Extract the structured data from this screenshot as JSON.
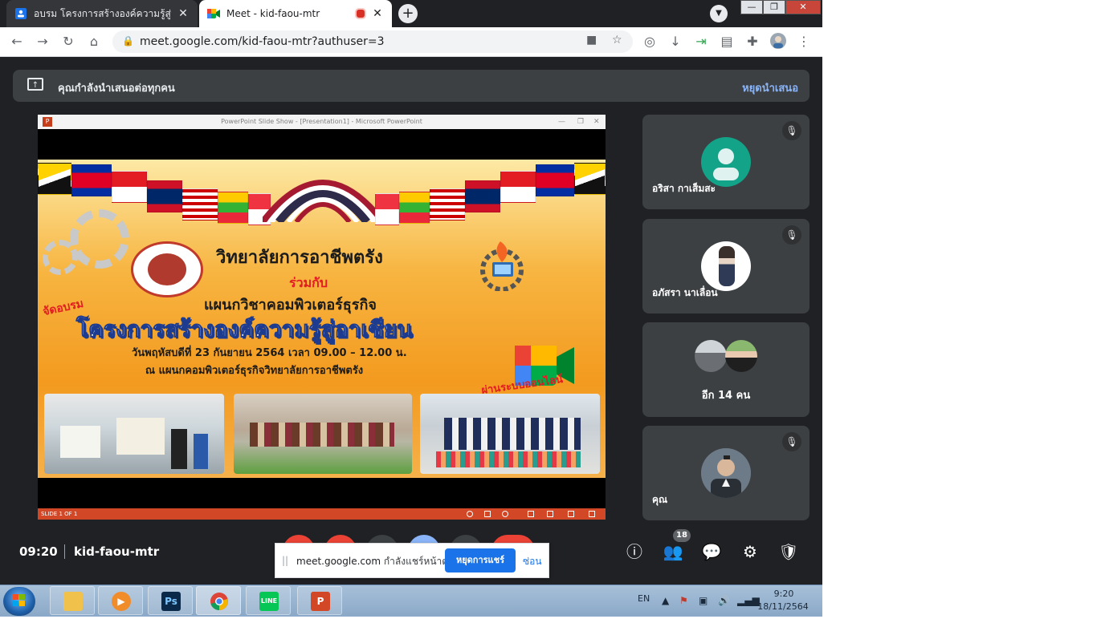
{
  "browser": {
    "tabs": [
      {
        "title": "อบรม โครงการสร้างองค์ความรู้สู่อาเซีย",
        "active": false
      },
      {
        "title": "Meet - kid-faou-mtr",
        "active": true
      }
    ],
    "new_tab": "+",
    "url": "meet.google.com/kid-faou-mtr?authuser=3"
  },
  "meet": {
    "banner_text": "คุณกำลังนำเสนอต่อทุกคน",
    "banner_stop": "หยุดนำเสนอ",
    "clock": "09:20",
    "meeting_code": "kid-faou-mtr",
    "participant_badge": "18"
  },
  "slide": {
    "window_title": "PowerPoint Slide Show - [Presentation1] - Microsoft PowerPoint",
    "line1": "วิทยาลัยการอาชีพตรัง",
    "line2": "ร่วมกับ",
    "line3": "แผนกวิชาคอมพิวเตอร์ธุรกิจ",
    "label_left": "จัดอบรม",
    "headline": "โครงการสร้างองค์ความรู้สู่อาเซียน",
    "date_line": "วันพฤหัสบดีที่ 23 กันยายน 2564 เวลา 09.00 – 12.00 น.",
    "place_line": "ณ แผนกคอมพิวเตอร์ธุรกิจวิทยาลัยการอาชีพตรัง",
    "online_label": "ผ่านระบบออนไลน์",
    "status_text": "SLIDE 1 OF 1"
  },
  "participants": [
    {
      "name": "อริสา กาเส็มสะ",
      "muted": true
    },
    {
      "name": "อภัสรา นาเลื่อน",
      "muted": true
    },
    {
      "name": "อีก 14 คน",
      "muted": false
    },
    {
      "name": "คุณ",
      "muted": true
    }
  ],
  "sharebar": {
    "domain": "meet.google.com",
    "message": "กำลังแชร์หน้าต่าง",
    "stop_label": "หยุดการแชร์",
    "hide_label": "ซ่อน"
  },
  "taskbar": {
    "apps": [
      "explorer",
      "media-player",
      "photoshop",
      "chrome",
      "line",
      "powerpoint"
    ],
    "ps_label": "Ps",
    "line_label": "LINE",
    "ppt_label": "P",
    "lang": "EN",
    "time": "9:20",
    "date": "18/11/2564"
  },
  "colors": {
    "meet_bg": "#202124",
    "tile_bg": "#3c4043",
    "accent_blue": "#1a73e8",
    "link_blue": "#8ab4f8"
  }
}
